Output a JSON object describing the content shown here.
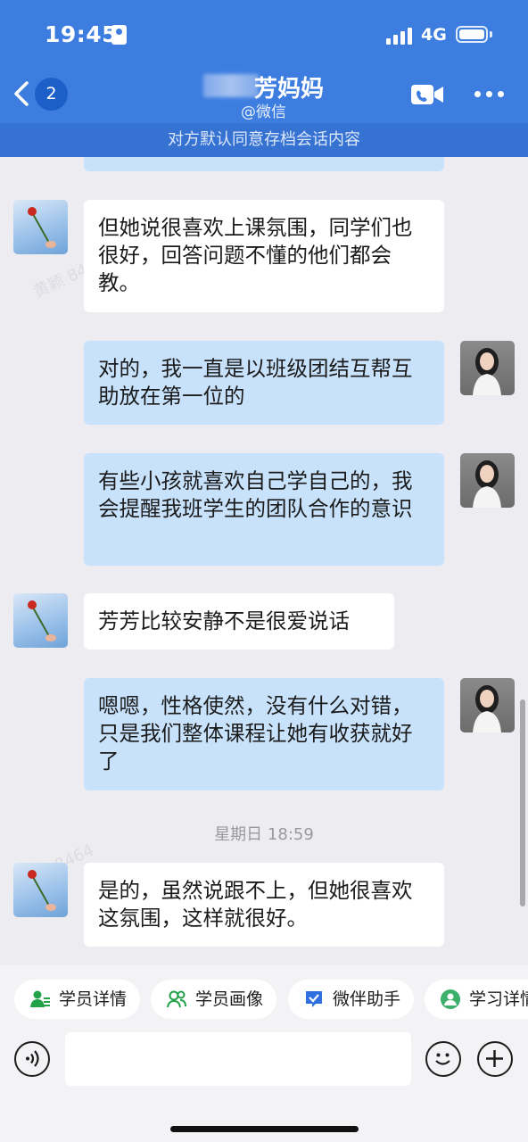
{
  "status_bar": {
    "time": "19:45",
    "network": "4G"
  },
  "header": {
    "back_badge": "2",
    "title": "芳妈妈",
    "subtitle": "@微信",
    "archive_notice": "对方默认同意存档会话内容"
  },
  "messages": [
    {
      "side": "in",
      "text": "但她说很喜欢上课氛围，同学们也很好，回答问题不懂的他们都会教。"
    },
    {
      "side": "out",
      "text": "对的，我一直是以班级团结互帮互助放在第一位的"
    },
    {
      "side": "out",
      "text": "有些小孩就喜欢自己学自己的，我会提醒我班学生的团队合作的意识"
    },
    {
      "side": "in",
      "text": "芳芳比较安静不是很爱说话"
    },
    {
      "side": "out",
      "text": "嗯嗯，性格使然，没有什么对错，只是我们整体课程让她有收获就好了"
    },
    {
      "side": "in",
      "text": "是的，虽然说跟不上，但她很喜欢这氛围，这样就很好。"
    }
  ],
  "timestamp": "星期日 18:59",
  "watermark": "黄颖 8464",
  "toolbar": {
    "chips": [
      "学员详情",
      "学员画像",
      "微伴助手",
      "学习详情"
    ],
    "input_value": ""
  },
  "colors": {
    "header": "#3d7de0",
    "bubble_out": "#c8e2fb",
    "bubble_in": "#ffffff",
    "background": "#ececf1"
  }
}
